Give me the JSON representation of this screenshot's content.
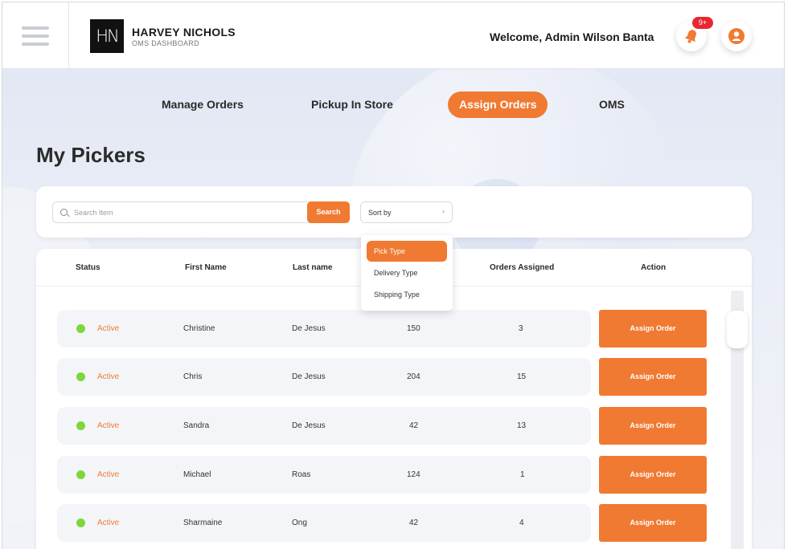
{
  "header": {
    "logo_text": "HN",
    "brand_name": "HARVEY NICHOLS",
    "brand_subtitle": "OMS DASHBOARD",
    "welcome_text": "Welcome, Admin Wilson Banta",
    "notification_badge": "9+"
  },
  "nav": {
    "tabs": [
      {
        "label": "Manage Orders",
        "active": false
      },
      {
        "label": "Pickup In Store",
        "active": false
      },
      {
        "label": "Assign Orders",
        "active": true
      },
      {
        "label": "OMS",
        "active": false
      }
    ]
  },
  "page": {
    "title": "My Pickers"
  },
  "search": {
    "placeholder": "Search Item",
    "button_label": "Search",
    "sort_label": "Sort by",
    "sort_chevron": "›"
  },
  "sort_dropdown": {
    "options": [
      "Pick Type",
      "Delivery Type",
      "Shipping Type"
    ],
    "selected": "Pick Type"
  },
  "table": {
    "headers": [
      "Status",
      "First Name",
      "Last name",
      "Orders Assigned",
      "Action"
    ],
    "rows": [
      {
        "status": "Active",
        "first_name": "Christine",
        "last_name": "De Jesus",
        "value": "150",
        "orders_assigned": "3",
        "action": "Assign Order"
      },
      {
        "status": "Active",
        "first_name": "Chris",
        "last_name": "De Jesus",
        "value": "204",
        "orders_assigned": "15",
        "action": "Assign Order"
      },
      {
        "status": "Active",
        "first_name": "Sandra",
        "last_name": "De Jesus",
        "value": "42",
        "orders_assigned": "13",
        "action": "Assign Order"
      },
      {
        "status": "Active",
        "first_name": "Michael",
        "last_name": "Roas",
        "value": "124",
        "orders_assigned": "1",
        "action": "Assign Order"
      },
      {
        "status": "Active",
        "first_name": "Sharmaine",
        "last_name": "Ong",
        "value": "42",
        "orders_assigned": "4",
        "action": "Assign Order"
      }
    ]
  },
  "colors": {
    "accent": "#f07a32",
    "status_active": "#7fd63a",
    "badge": "#e8262f"
  },
  "icons": {
    "menu": "hamburger-icon",
    "notifications": "bell-icon",
    "profile": "user-icon",
    "search": "search-icon",
    "sort": "chevron-right-icon"
  }
}
